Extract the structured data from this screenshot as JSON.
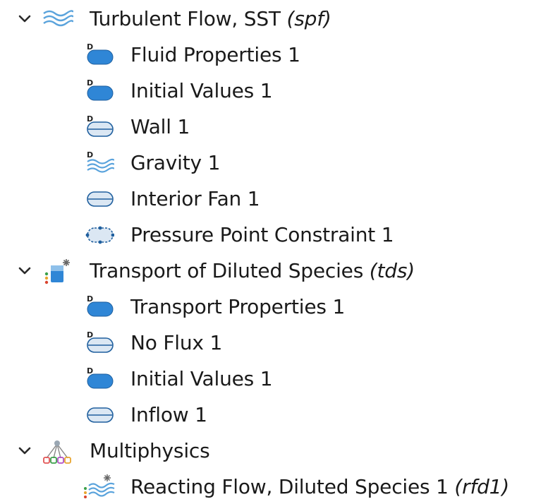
{
  "colors": {
    "blue_fill": "#2f86d6",
    "light_fill": "#dbe7f3",
    "edge": "#1f5f9e",
    "wave": "#5aa3dc",
    "chevron": "#2a2a2a"
  },
  "tree": {
    "nodes": [
      {
        "label": "Turbulent Flow, SST",
        "tag": "(spf)",
        "icon": "turbulent-flow-icon",
        "expanded": true,
        "children": [
          {
            "label": "Fluid Properties 1",
            "icon": "domain-blue-icon"
          },
          {
            "label": "Initial Values 1",
            "icon": "domain-blue-icon"
          },
          {
            "label": "Wall 1",
            "icon": "boundary-default-icon"
          },
          {
            "label": "Gravity 1",
            "icon": "domain-waves-icon"
          },
          {
            "label": "Interior Fan 1",
            "icon": "boundary-icon"
          },
          {
            "label": "Pressure Point Constraint 1",
            "icon": "point-icon"
          }
        ]
      },
      {
        "label": "Transport of Diluted Species",
        "tag": "(tds)",
        "icon": "transport-species-icon",
        "expanded": true,
        "children": [
          {
            "label": "Transport Properties 1",
            "icon": "domain-blue-icon"
          },
          {
            "label": "No Flux 1",
            "icon": "boundary-default-icon"
          },
          {
            "label": "Initial Values 1",
            "icon": "domain-blue-icon"
          },
          {
            "label": "Inflow 1",
            "icon": "boundary-icon"
          }
        ]
      },
      {
        "label": "Multiphysics",
        "tag": "",
        "icon": "multiphysics-icon",
        "expanded": true,
        "children": [
          {
            "label": "Reacting Flow, Diluted Species 1",
            "tag": "(rfd1)",
            "icon": "reacting-flow-icon"
          }
        ]
      }
    ]
  }
}
